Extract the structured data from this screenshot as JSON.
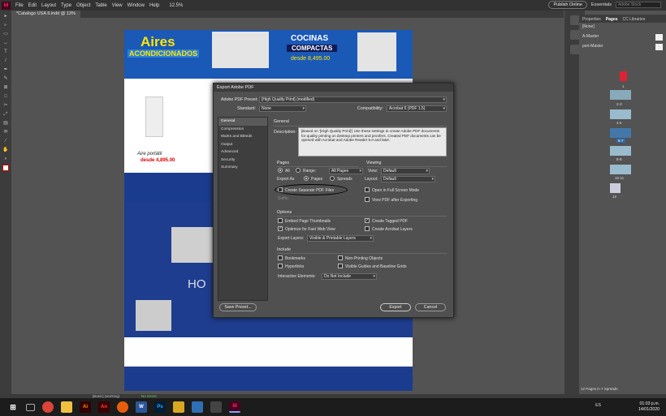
{
  "app": {
    "logo": "Id",
    "menu": [
      "File",
      "Edit",
      "Layout",
      "Type",
      "Object",
      "Table",
      "View",
      "Window",
      "Help"
    ],
    "zoom": "12.5%",
    "publish": "Publish Online",
    "workspace": "Essentials",
    "search_placeholder": "Adobe Stock"
  },
  "document_tab": "*Catalogo USA II.indd @ 13%",
  "dialog": {
    "title": "Export Adobe PDF",
    "preset_label": "Adobe PDF Preset:",
    "preset_value": "[High Quality Print] (modified)",
    "standard_label": "Standard:",
    "standard_value": "None",
    "compat_label": "Compatibility:",
    "compat_value": "Acrobat 6 (PDF 1.5)",
    "categories": [
      "General",
      "Compression",
      "Marks and Bleeds",
      "Output",
      "Advanced",
      "Security",
      "Summary"
    ],
    "section_title": "General",
    "description_label": "Description:",
    "description": "[Based on '[High Quality Print]'] Use these settings to create Adobe PDF documents for quality printing on desktop printers and proofers. Created PDF documents can be opened with Acrobat and Adobe Reader 5.0 and later.",
    "pages": {
      "title": "Pages",
      "all": "All",
      "range": "Range:",
      "range_value": "All Pages",
      "export_as": "Export As",
      "opt_pages": "Pages",
      "opt_spreads": "Spreads",
      "create_separate": "Create Separate PDF Files",
      "suffix": "Suffix:"
    },
    "viewing": {
      "title": "Viewing",
      "view_label": "View:",
      "view_value": "Default",
      "layout_label": "Layout:",
      "layout_value": "Default",
      "open_full": "Open in Full Screen Mode",
      "view_after": "View PDF after Exporting"
    },
    "options": {
      "title": "Options",
      "embed_thumbs": "Embed Page Thumbnails",
      "optimize": "Optimize for Fast Web View",
      "tagged": "Create Tagged PDF",
      "acrobat_layers": "Create Acrobat Layers",
      "export_layers_label": "Export Layers:",
      "export_layers_value": "Visible & Printable Layers"
    },
    "include": {
      "title": "Include",
      "bookmarks": "Bookmarks",
      "hyperlinks": "Hyperlinks",
      "nonprinting": "Non-Printing Objects",
      "visible_guides": "Visible Guides and Baseline Grids",
      "interactive_label": "Interactive Elements:",
      "interactive_value": "Do Not Include"
    },
    "save_preset": "Save Preset...",
    "export": "Export",
    "cancel": "Cancel"
  },
  "panel": {
    "tabs": [
      "Properties",
      "Pages",
      "CC Libraries"
    ],
    "masters": [
      "[None]",
      "A-Master",
      "port-Master"
    ],
    "page_labels": [
      "1",
      "2-3",
      "4-5",
      "6-7",
      "8-9",
      "10-11",
      "12"
    ],
    "footer": "12 Pages in 7 Spreads"
  },
  "status": {
    "preflight": "[Basic] (working)",
    "errors": "No errors"
  },
  "catalog": {
    "aires": "Aires",
    "acondicionados": "ACONDICIONADOS",
    "cocinas": "COCINAS",
    "compactas": "COMPACTAS",
    "desde_price": "desde 8,495.00",
    "aire_portatil": "Aire portátil",
    "desde_price2": "desde 4,895.00",
    "ho": "HO"
  },
  "taskbar": {
    "lang": "ES",
    "time": "01:03 p.m.",
    "date": "14/01/2020"
  }
}
